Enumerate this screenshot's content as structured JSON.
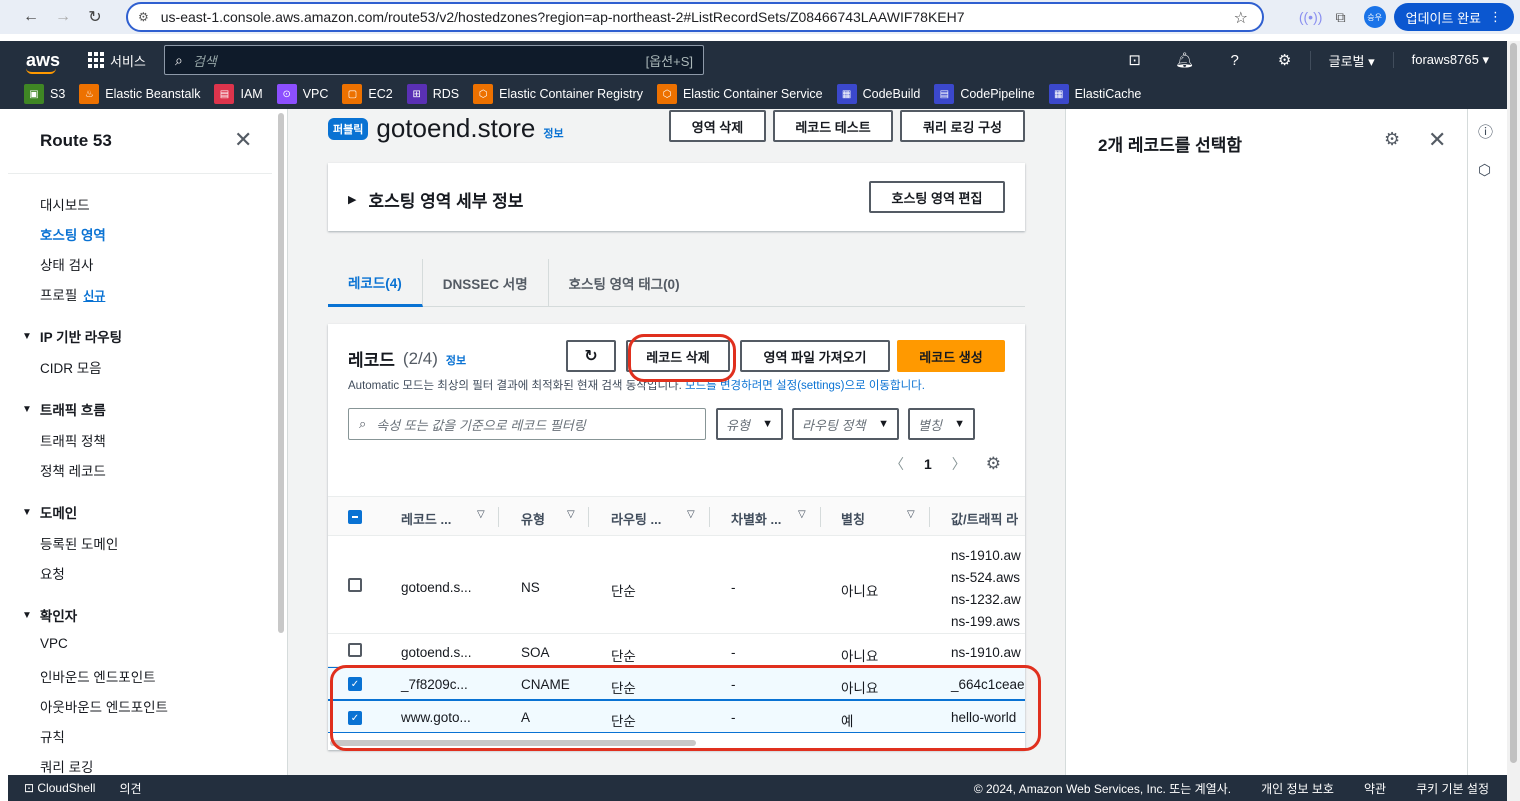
{
  "browser": {
    "url": "us-east-1.console.aws.amazon.com/route53/v2/hostedzones?region=ap-northeast-2#ListRecordSets/Z08466743LAAWIF78KEH7",
    "profile": "승우",
    "update_label": "업데이트 완료"
  },
  "aws_nav": {
    "logo": "aws",
    "services": "서비스",
    "search_placeholder": "검색",
    "search_shortcut": "[옵션+S]",
    "region": "글로벌",
    "account": "foraws8765"
  },
  "favorites": [
    {
      "label": "S3",
      "color": "#3f8624"
    },
    {
      "label": "Elastic Beanstalk",
      "color": "#ed7100"
    },
    {
      "label": "IAM",
      "color": "#dd344c"
    },
    {
      "label": "VPC",
      "color": "#8c4fff"
    },
    {
      "label": "EC2",
      "color": "#ed7100"
    },
    {
      "label": "RDS",
      "color": "#5a30b5"
    },
    {
      "label": "Elastic Container Registry",
      "color": "#ed7100"
    },
    {
      "label": "Elastic Container Service",
      "color": "#ed7100"
    },
    {
      "label": "CodeBuild",
      "color": "#3b48cc"
    },
    {
      "label": "CodePipeline",
      "color": "#3b48cc"
    },
    {
      "label": "ElastiCache",
      "color": "#3b48cc"
    }
  ],
  "sidebar": {
    "title": "Route 53",
    "items": {
      "dashboard": "대시보드",
      "hosted_zones": "호스팅 영역",
      "health_checks": "상태 검사",
      "profiles": "프로필",
      "profiles_new": "신규",
      "ip_routing": "IP 기반 라우팅",
      "cidr": "CIDR 모음",
      "traffic_flow": "트래픽 흐름",
      "traffic_policy": "트래픽 정책",
      "policy_records": "정책 레코드",
      "domains": "도메인",
      "registered_domains": "등록된 도메인",
      "requests": "요청",
      "resolver": "확인자",
      "vpc": "VPC",
      "inbound": "인바운드 엔드포인트",
      "outbound": "아웃바운드 엔드포인트",
      "rules": "규칙",
      "query_logging": "쿼리 로깅"
    }
  },
  "zone": {
    "badge": "퍼블릭",
    "name": "gotoend.store",
    "info": "정보",
    "delete_zone": "영역 삭제",
    "test_record": "레코드 테스트",
    "query_logging": "쿼리 로깅 구성",
    "details_title": "호스팅 영역 세부 정보",
    "edit_zone": "호스팅 영역 편집"
  },
  "tabs": [
    "레코드(4)",
    "DNSSEC 서명",
    "호스팅 영역 태그(0)"
  ],
  "records": {
    "title": "레코드",
    "count": "(2/4)",
    "info": "정보",
    "delete_btn": "레코드 삭제",
    "import_btn": "영역 파일 가져오기",
    "create_btn": "레코드 생성",
    "desc_prefix": "Automatic 모드는 최상의 필터 결과에 최적화된 현재 검색 동작입니다.",
    "desc_link": "모드를 변경하려면 설정(settings)으로 이동합니다.",
    "filter_placeholder": "속성 또는 값을 기준으로 레코드 필터링",
    "dd_type": "유형",
    "dd_routing": "라우팅 정책",
    "dd_alias": "별칭",
    "page": "1",
    "columns": [
      "레코드 ...",
      "유형",
      "라우팅 ...",
      "차별화 ...",
      "별칭",
      "값/트래픽 라"
    ],
    "rows": [
      {
        "name": "gotoend.s...",
        "type": "NS",
        "routing": "단순",
        "diff": "-",
        "alias": "아니요",
        "values": [
          "ns-1910.aw",
          "ns-524.aws",
          "ns-1232.aw",
          "ns-199.aws"
        ],
        "checked": false
      },
      {
        "name": "gotoend.s...",
        "type": "SOA",
        "routing": "단순",
        "diff": "-",
        "alias": "아니요",
        "values": [
          "ns-1910.aw"
        ],
        "checked": false
      },
      {
        "name": "_7f8209c...",
        "type": "CNAME",
        "routing": "단순",
        "diff": "-",
        "alias": "아니요",
        "values": [
          "_664c1ceae"
        ],
        "checked": true
      },
      {
        "name": "www.goto...",
        "type": "A",
        "routing": "단순",
        "diff": "-",
        "alias": "예",
        "values": [
          "hello-world"
        ],
        "checked": true
      }
    ]
  },
  "right_panel": {
    "title": "2개 레코드를 선택함"
  },
  "footer": {
    "cloudshell": "CloudShell",
    "feedback": "의견",
    "copyright": "© 2024, Amazon Web Services, Inc. 또는 계열사.",
    "privacy": "개인 정보 보호",
    "terms": "약관",
    "cookies": "쿠키 기본 설정"
  }
}
